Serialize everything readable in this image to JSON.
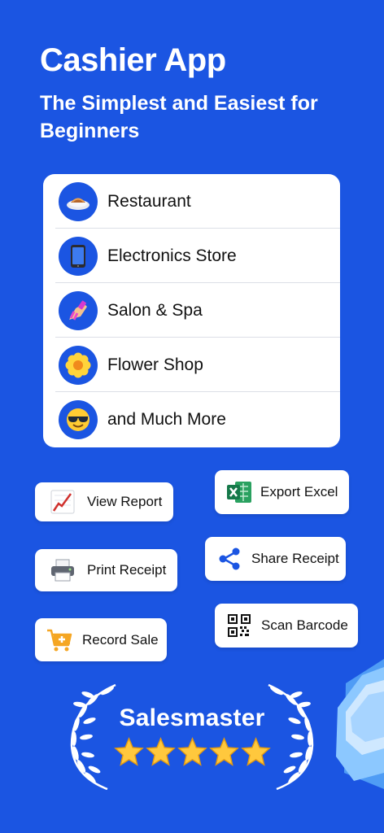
{
  "header": {
    "title": "Cashier App",
    "subtitle": "The Simplest and Easiest for Beginners"
  },
  "categories": [
    {
      "label": "Restaurant",
      "icon": "food-plate-icon"
    },
    {
      "label": "Electronics Store",
      "icon": "smartphone-icon"
    },
    {
      "label": "Salon & Spa",
      "icon": "nail-polish-icon"
    },
    {
      "label": "Flower Shop",
      "icon": "flower-icon"
    },
    {
      "label": "and Much More",
      "icon": "sunglasses-face-icon"
    }
  ],
  "features": {
    "view_report": {
      "label": "View Report",
      "icon": "chart-up-icon"
    },
    "export_excel": {
      "label": "Export Excel",
      "icon": "excel-icon"
    },
    "print_receipt": {
      "label": "Print Receipt",
      "icon": "printer-icon"
    },
    "share_receipt": {
      "label": "Share Receipt",
      "icon": "share-icon"
    },
    "record_sale": {
      "label": "Record Sale",
      "icon": "cart-add-icon"
    },
    "scan_barcode": {
      "label": "Scan Barcode",
      "icon": "qr-code-icon"
    }
  },
  "badge": {
    "brand": "Salesmaster",
    "rating": 5,
    "max_rating": 5
  },
  "colors": {
    "background": "#1b55e2",
    "card": "#ffffff",
    "star": "#ffc83d",
    "excel_green": "#1f9d55",
    "share_blue": "#1b55e2",
    "cart_orange": "#f5a623"
  }
}
